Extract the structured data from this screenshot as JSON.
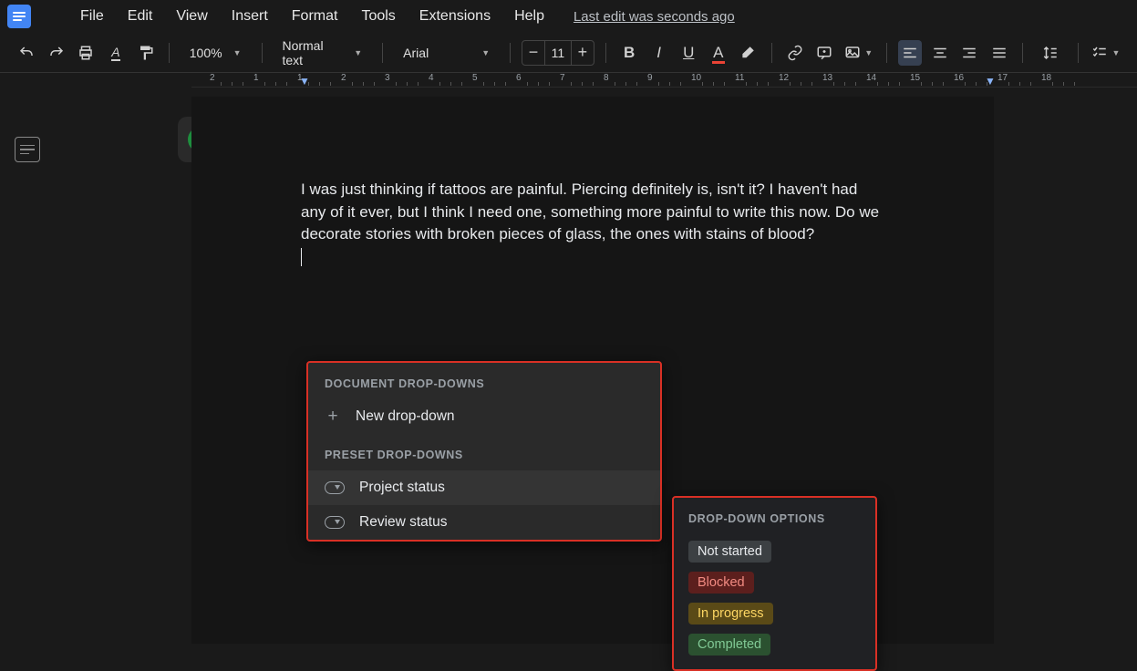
{
  "menu": {
    "file": "File",
    "edit": "Edit",
    "view": "View",
    "insert": "Insert",
    "format": "Format",
    "tools": "Tools",
    "extensions": "Extensions",
    "help": "Help",
    "last_edit": "Last edit was seconds ago"
  },
  "toolbar": {
    "zoom": "100%",
    "style": "Normal text",
    "font": "Arial",
    "font_size": "11"
  },
  "ruler": {
    "ticks": [
      "2",
      "1",
      "1",
      "2",
      "3",
      "4",
      "5",
      "6",
      "7",
      "8",
      "9",
      "10",
      "11",
      "12",
      "13",
      "14",
      "15",
      "16",
      "17",
      "18"
    ]
  },
  "document": {
    "body_text": "I was just thinking if tattoos are painful. Piercing definitely is, isn't it? I haven't had any of it ever, but I think I need one, something more painful to write this now. Do we decorate stories with broken pieces of glass, the ones with stains of blood?"
  },
  "dropdown_menu": {
    "section1": "DOCUMENT DROP-DOWNS",
    "new_dropdown": "New drop-down",
    "section2": "PRESET DROP-DOWNS",
    "project_status": "Project status",
    "review_status": "Review status"
  },
  "options_panel": {
    "title": "DROP-DOWN OPTIONS",
    "not_started": "Not started",
    "blocked": "Blocked",
    "in_progress": "In progress",
    "completed": "Completed"
  }
}
